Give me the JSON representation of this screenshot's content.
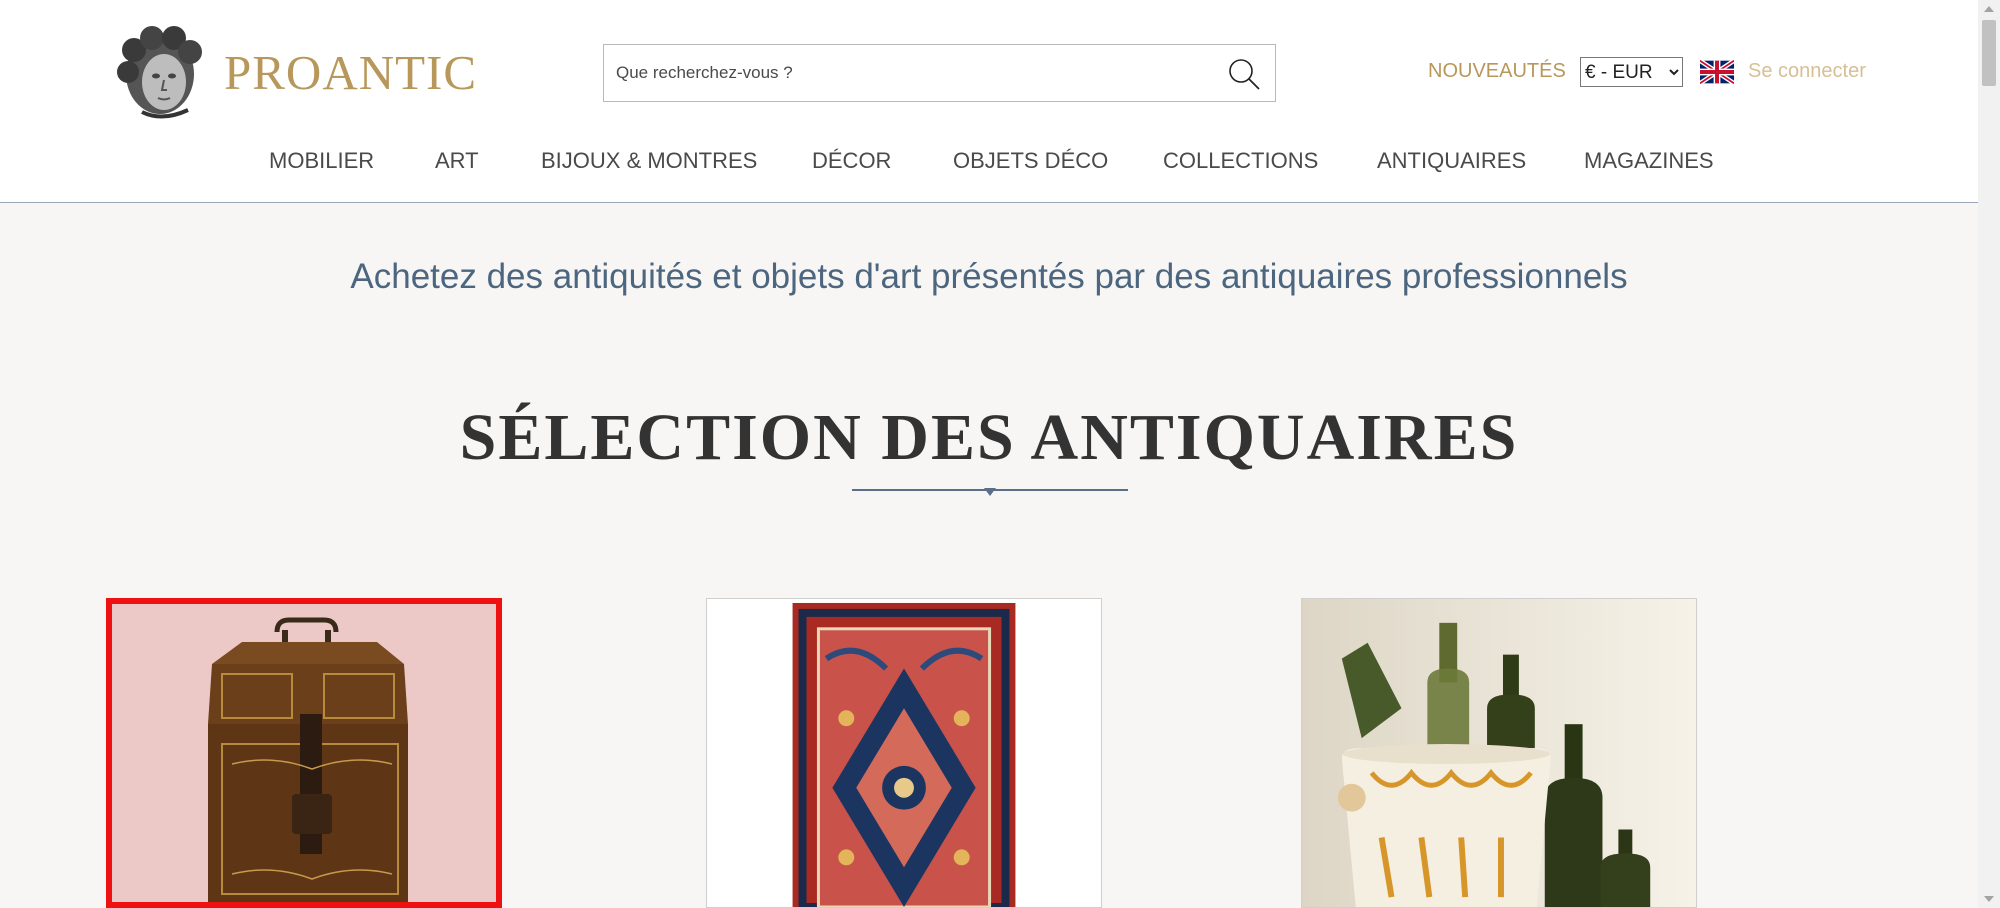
{
  "header": {
    "logo_text": "PROANTIC",
    "search_placeholder": "Que recherchez-vous ?",
    "new_items_label": "NOUVEAUTÉS",
    "currency_selected": "€ - EUR",
    "language_flag": "uk-flag-icon",
    "login_label": "Se connecter",
    "accent_color": "#b8975a"
  },
  "nav": {
    "items": [
      {
        "label": "MOBILIER"
      },
      {
        "label": "ART"
      },
      {
        "label": "BIJOUX & MONTRES"
      },
      {
        "label": "DÉCOR"
      },
      {
        "label": "OBJETS DÉCO"
      },
      {
        "label": "COLLECTIONS"
      },
      {
        "label": "ANTIQUAIRES"
      },
      {
        "label": "MAGAZINES"
      }
    ]
  },
  "main": {
    "tagline": "Achetez des antiquités et objets d'art présentés par des antiquaires professionnels",
    "section_title": "SÉLECTION DES ANTIQUAIRES",
    "cards": [
      {
        "image": "antique-leather-box",
        "selected": true
      },
      {
        "image": "persian-rug",
        "selected": false
      },
      {
        "image": "glass-bottles-and-wine-cooler",
        "selected": false
      }
    ]
  }
}
